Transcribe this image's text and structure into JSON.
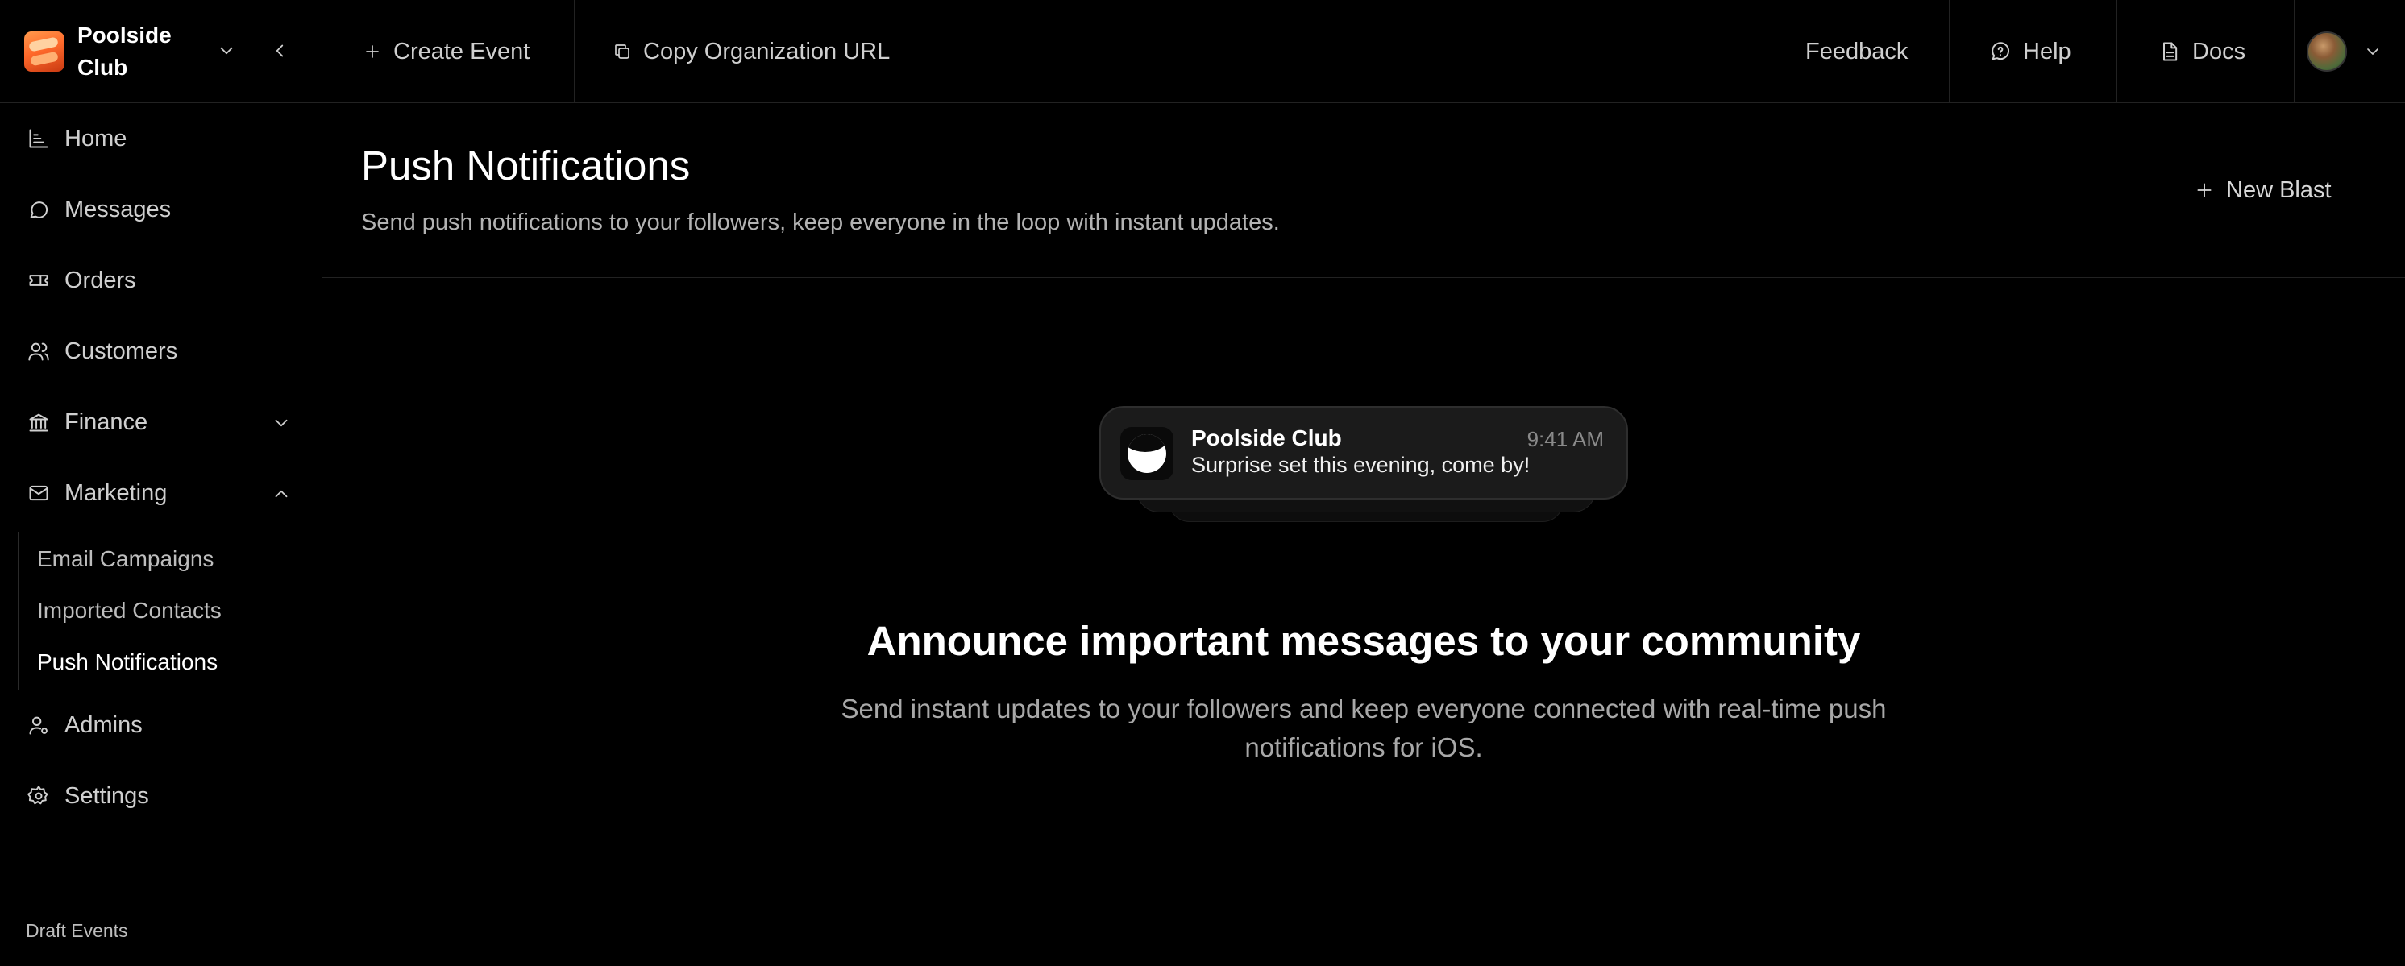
{
  "organization": {
    "name": "Poolside Club"
  },
  "topbar": {
    "create_event": "Create Event",
    "copy_url": "Copy Organization URL",
    "feedback": "Feedback",
    "help": "Help",
    "docs": "Docs"
  },
  "sidebar": {
    "items": {
      "home": "Home",
      "messages": "Messages",
      "orders": "Orders",
      "customers": "Customers",
      "finance": "Finance",
      "marketing": "Marketing",
      "admins": "Admins",
      "settings": "Settings"
    },
    "marketing_sub": {
      "email_campaigns": "Email Campaigns",
      "imported_contacts": "Imported Contacts",
      "push_notifications": "Push Notifications"
    },
    "draft_events": "Draft Events"
  },
  "page": {
    "title": "Push Notifications",
    "subtitle": "Send push notifications to your followers, keep everyone in the loop with instant updates.",
    "new_blast": "New Blast"
  },
  "notification_preview": {
    "app_name": "Poolside Club",
    "time": "9:41 AM",
    "message": "Surprise set this evening, come by!"
  },
  "empty_state": {
    "title": "Announce important messages to your community",
    "description": "Send instant updates to your followers and keep everyone connected with real-time push notifications for iOS."
  },
  "theme": {
    "background": "#000000",
    "border": "#222222",
    "text": "#cfcfcf"
  }
}
